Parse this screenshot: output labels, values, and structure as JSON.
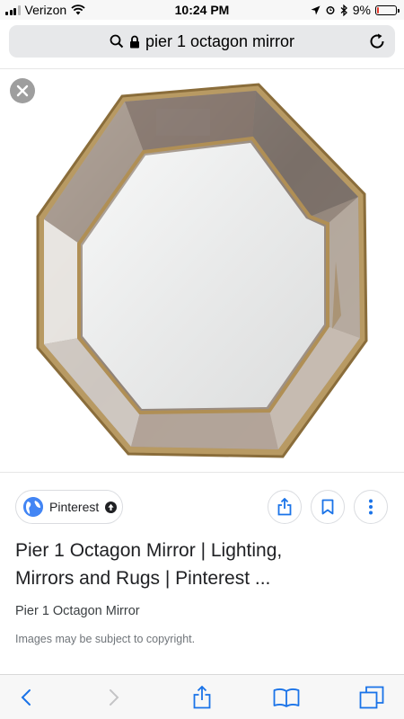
{
  "status_bar": {
    "carrier": "Verizon",
    "time": "10:24 PM",
    "battery_percent": "9%",
    "battery_level": 0.09,
    "battery_color": "#e8392a"
  },
  "address_bar": {
    "query": "pier 1 octagon mirror",
    "icons": [
      "search-icon",
      "lock-icon",
      "reload-icon"
    ]
  },
  "viewer": {
    "close_icon": "close-icon",
    "image_subject": "octagon-mirror"
  },
  "result": {
    "source": "Pinterest",
    "source_icons": [
      "globe-icon",
      "open-arrow-icon"
    ],
    "actions": [
      "share-icon",
      "bookmark-icon",
      "more-vert-icon"
    ],
    "title_line1": "Pier 1 Octagon Mirror | Lighting,",
    "title_line2": "Mirrors and Rugs | Pinterest ...",
    "subtitle": "Pier 1 Octagon Mirror",
    "copyright": "Images may be subject to copyright."
  },
  "toolbar": {
    "icons": [
      "back-icon",
      "forward-icon",
      "share-icon",
      "bookmarks-icon",
      "tabs-icon"
    ],
    "accent": "#1a73e8"
  }
}
